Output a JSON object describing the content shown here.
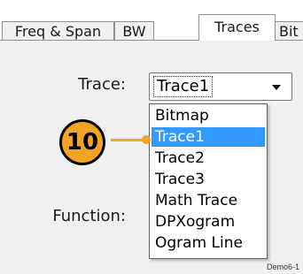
{
  "tabs": [
    {
      "label": "Freq & Span"
    },
    {
      "label": "BW"
    },
    {
      "label": "Traces",
      "active": true
    },
    {
      "label": "Bit"
    }
  ],
  "trace_field": {
    "label": "Trace:",
    "value": "Trace1"
  },
  "function_field": {
    "label": "Function:"
  },
  "dropdown": {
    "options": [
      "Bitmap",
      "Trace1",
      "Trace2",
      "Trace3",
      "Math Trace",
      "DPXogram",
      "Ogram Line"
    ],
    "selected": "Trace1"
  },
  "callout": {
    "number": "10"
  },
  "watermark": "Demo6-1",
  "colors": {
    "callout": "#f4a425",
    "selection": "#3399ff",
    "panel": "#f0f0f0"
  },
  "icons": {
    "combo_arrow": "chevron-down-icon"
  }
}
